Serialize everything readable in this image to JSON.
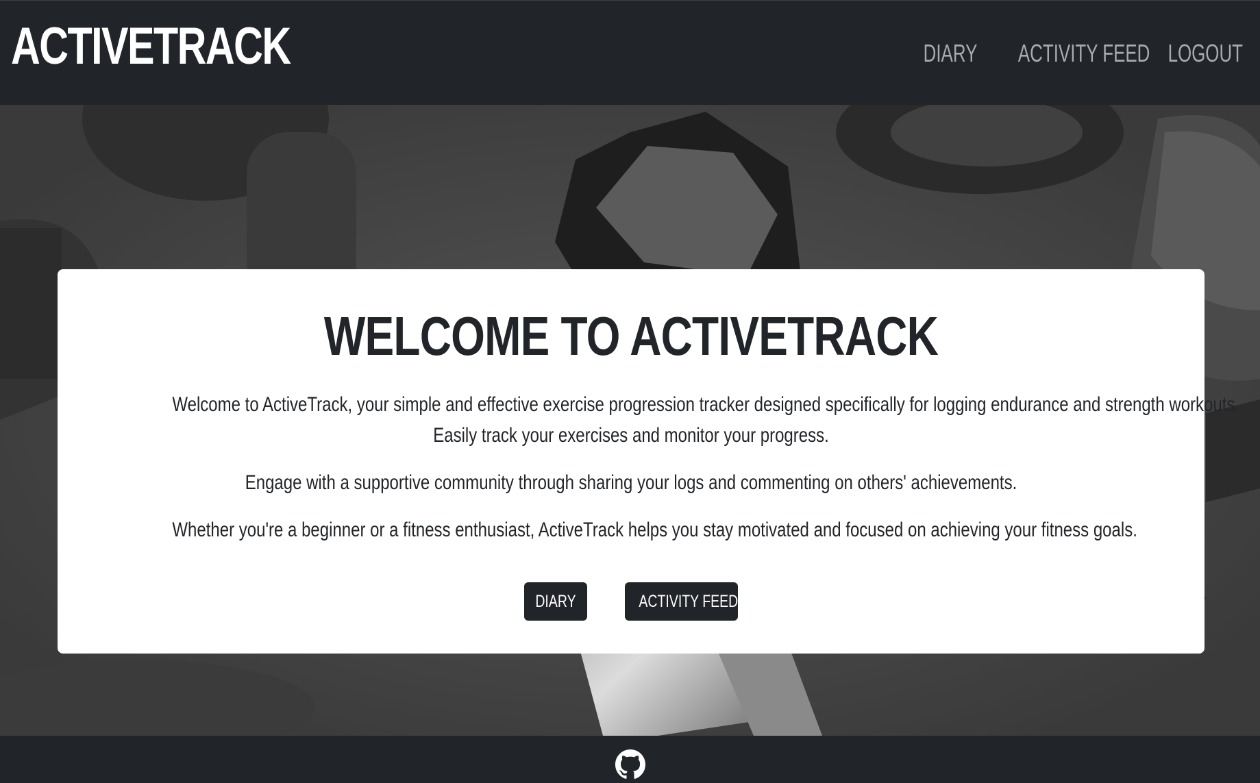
{
  "navbar": {
    "brand": "ACTIVETRACK",
    "links": [
      {
        "label": "DIARY"
      },
      {
        "label": "ACTIVITY FEED"
      },
      {
        "label": "LOGOUT"
      }
    ]
  },
  "hero": {
    "title": "WELCOME TO ACTIVETRACK",
    "paragraphs": [
      "Welcome to ActiveTrack, your simple and effective exercise progression tracker designed specifically for logging endurance and strength workouts.",
      "Easily track your exercises and monitor your progress.",
      "Engage with a supportive community through sharing your logs and commenting on others' achievements.",
      "Whether you're a beginner or a fitness enthusiast, ActiveTrack helps you stay motivated and focused on achieving your fitness goals."
    ],
    "buttons": [
      {
        "label": "DIARY"
      },
      {
        "label": "ACTIVITY FEED"
      }
    ]
  },
  "footer": {
    "icon": "github-icon"
  },
  "colors": {
    "dark": "#212529",
    "nav_link": "#a8abae",
    "card": "#ffffff"
  }
}
